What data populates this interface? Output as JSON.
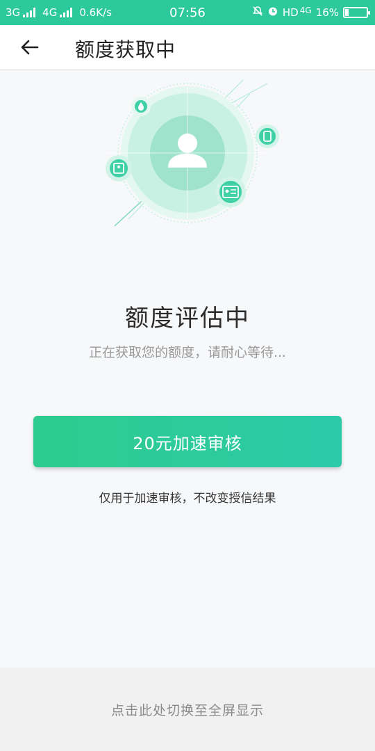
{
  "status_bar": {
    "network1": "3G",
    "network2": "4G",
    "speed": "0.6K/s",
    "time": "07:56",
    "hd": "HD",
    "volte": "4G",
    "battery": "16%",
    "battery_level": 0.16
  },
  "app_bar": {
    "title": "额度获取中"
  },
  "main": {
    "heading": "额度评估中",
    "subheading": "正在获取您的额度，请耐心等待...",
    "cta_label": "20元加速审核",
    "note": "仅用于加速审核，不改变授信结果"
  },
  "bottom": {
    "label": "点击此处切换至全屏显示"
  },
  "colors": {
    "accent": "#2dc89c",
    "illus_light": "#d9f5ec",
    "illus_mid": "#b5ecdb",
    "illus_dark": "#7ed9bd"
  }
}
